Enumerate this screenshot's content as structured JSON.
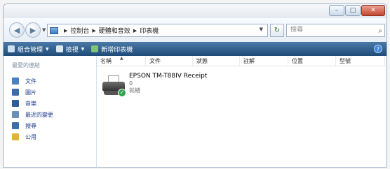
{
  "window": {
    "buttons": {
      "minimize": "–",
      "maximize": "□",
      "close": "✕"
    }
  },
  "nav": {
    "back": "◀",
    "forward": "▶",
    "dropdown": "▼"
  },
  "address": {
    "breadcrumbs": [
      "控制台",
      "硬體和音效",
      "印表機"
    ],
    "dropdown": "▼",
    "refresh": "↻"
  },
  "search": {
    "placeholder": "搜尋",
    "icon": "⌕"
  },
  "toolbar": {
    "organize": "組合管理",
    "views": "檢視",
    "add_printer": "新增印表機",
    "arrow": "▼",
    "help": "?"
  },
  "sidebar": {
    "title": "最愛的連結",
    "items": [
      {
        "label": "文件",
        "color": "#4a7fc1"
      },
      {
        "label": "圖片",
        "color": "#3a6ea8"
      },
      {
        "label": "音樂",
        "color": "#2f5e99"
      },
      {
        "label": "最近的變更",
        "color": "#6a8fb8"
      },
      {
        "label": "搜尋",
        "color": "#3a6ea8"
      },
      {
        "label": "公用",
        "color": "#e0b23a"
      }
    ]
  },
  "columns": [
    "名稱",
    "文件",
    "狀態",
    "註解",
    "位置",
    "型號"
  ],
  "printer": {
    "name": "EPSON TM-T88IV Receipt",
    "documents": "0",
    "status": "就緒",
    "check": "✓"
  }
}
